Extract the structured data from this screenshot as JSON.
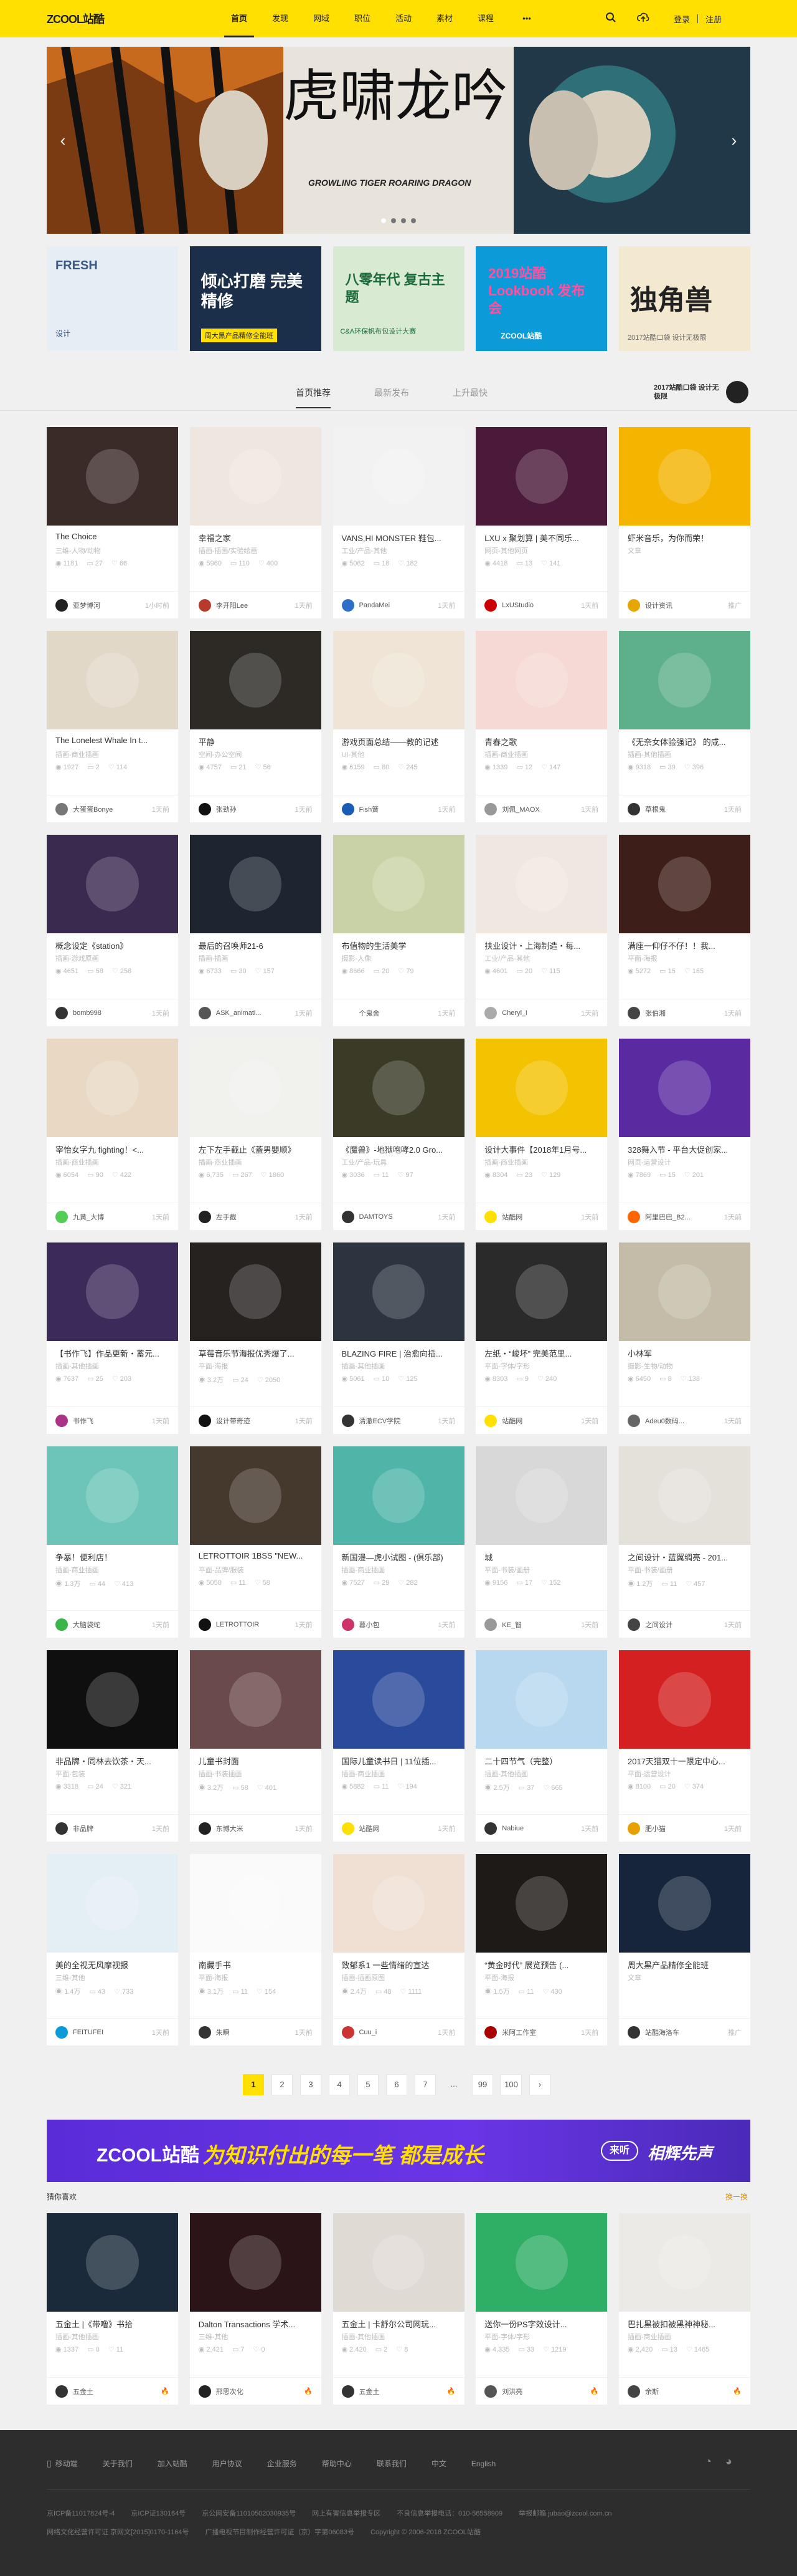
{
  "header": {
    "logo_text": "ZCOOL站酷",
    "nav": [
      "首页",
      "发现",
      "网域",
      "职位",
      "活动",
      "素材",
      "课程"
    ],
    "more": "•••",
    "search_icon": "search-icon",
    "upload_icon": "upload-icon",
    "login": "登录",
    "register": "注册"
  },
  "banner": {
    "caption": "GROWLING TIGER ROARING DRAGON",
    "big_text": "虎啸龙吟"
  },
  "thumbs": [
    {
      "label": "FRESH",
      "color": "#e6edf5",
      "text2": "设计"
    },
    {
      "label": "倾心打磨 完美精修",
      "color": "#1b2f4a",
      "text2": "周大黑产品精修全能班"
    },
    {
      "label": "八零年代 复古主题",
      "color": "#d9ead3",
      "text2": "C&A环保帆布包设计大赛"
    },
    {
      "label": "2019站酷 Lookbook 发布会",
      "color": "#0a9bd8",
      "text2": "ZCOOL站酷"
    },
    {
      "label": "独角兽",
      "color": "#f3e8d0",
      "text2": "2017站酷口袋 设计无极限"
    }
  ],
  "tabs": [
    "首页推荐",
    "最新发布",
    "上升最快"
  ],
  "promo": {
    "text": "2017站酷口袋 设计无极限"
  },
  "cards": [
    {
      "title": "The Choice",
      "sub": "三维-人物/动物",
      "views": "1181",
      "comments": "27",
      "likes": "66",
      "author": "亚梦博河",
      "time": "1小时前",
      "img": "#3a2a28",
      "av": "#222"
    },
    {
      "title": "幸福之家",
      "sub": "插画-插画/实验绘画",
      "views": "5960",
      "comments": "110",
      "likes": "400",
      "author": "李开阳Lee",
      "time": "1天前",
      "img": "#efe7df",
      "av": "#b83a2a"
    },
    {
      "title": "VANS,HI MONSTER 鞋包...",
      "sub": "工业/产品-其他",
      "views": "5062",
      "comments": "18",
      "likes": "182",
      "author": "PandaMei",
      "time": "1天前",
      "img": "#f2f2f2",
      "av": "#2d6ec8"
    },
    {
      "title": "LXU x 聚划算 | 美不同乐...",
      "sub": "网页-其他网页",
      "views": "4418",
      "comments": "13",
      "likes": "141",
      "author": "LxUStudio",
      "time": "1天前",
      "img": "#4b1a3a",
      "av": "#c00"
    },
    {
      "title": "虾米音乐，为你而荣！",
      "sub": "文章",
      "views": "",
      "comments": "",
      "likes": "",
      "author": "设计资讯",
      "time": "推广",
      "img": "#f5b400",
      "av": "#e8a400"
    },
    {
      "title": "The Lonelest Whale In t...",
      "sub": "插画-商业插画",
      "views": "1927",
      "comments": "2",
      "likes": "114",
      "author": "大蛋蛋Bonye",
      "time": "1天前",
      "img": "#e2d8c8",
      "av": "#777"
    },
    {
      "title": "平静",
      "sub": "空间-办公空间",
      "views": "4757",
      "comments": "21",
      "likes": "56",
      "author": "张劲孙",
      "time": "1天前",
      "img": "#2d2a26",
      "av": "#111"
    },
    {
      "title": "游戏页面总结——教的记述",
      "sub": "UI-其他",
      "views": "6159",
      "comments": "80",
      "likes": "245",
      "author": "Fish簧",
      "time": "1天前",
      "img": "#f0e4d6",
      "av": "#1a5bb5"
    },
    {
      "title": "青春之歌",
      "sub": "插画-商业插画",
      "views": "1339",
      "comments": "12",
      "likes": "147",
      "author": "刘佩_MAOX",
      "time": "1天前",
      "img": "#f6d9d4",
      "av": "#999"
    },
    {
      "title": "《无奈女体验强记》 的咸...",
      "sub": "插画-其他插画",
      "views": "9318",
      "comments": "39",
      "likes": "396",
      "author": "草根鬼",
      "time": "1天前",
      "img": "#5db08a",
      "av": "#333"
    },
    {
      "title": "概念设定《station》",
      "sub": "插画-游戏原画",
      "views": "4651",
      "comments": "58",
      "likes": "258",
      "author": "bomb998",
      "time": "1天前",
      "img": "#3a2a50",
      "av": "#333"
    },
    {
      "title": "最后的召唤师21-6",
      "sub": "插画-插画",
      "views": "6733",
      "comments": "30",
      "likes": "157",
      "author": "ASK_animati...",
      "time": "1天前",
      "img": "#1e2530",
      "av": "#555"
    },
    {
      "title": "布值物的生活美学",
      "sub": "摄影-人像",
      "views": "8666",
      "comments": "20",
      "likes": "79",
      "author": "个鬼舍",
      "time": "1天前",
      "img": "#c8d2a6",
      "av": "#fff"
    },
    {
      "title": "扶业设计・上海制造・每...",
      "sub": "工业/产品-其他",
      "views": "4601",
      "comments": "20",
      "likes": "115",
      "author": "Cheryl_i",
      "time": "1天前",
      "img": "#f0e8e0",
      "av": "#aaa"
    },
    {
      "title": "满座一仰仔不仔！！我...",
      "sub": "平面-海报",
      "views": "5272",
      "comments": "15",
      "likes": "165",
      "author": "张伯湘",
      "time": "1天前",
      "img": "#3e1e18",
      "av": "#444"
    },
    {
      "title": "宰怡女字九 fighting！<...",
      "sub": "插画-商业插画",
      "views": "6054",
      "comments": "90",
      "likes": "422",
      "author": "九黄_大博",
      "time": "1天前",
      "img": "#e9d8c4",
      "av": "#5c5"
    },
    {
      "title": "左下左手截止《蓋男嬰顺》",
      "sub": "插画-商业插画",
      "views": "6,735",
      "comments": "267",
      "likes": "1860",
      "author": "左手截",
      "time": "1天前",
      "img": "#f1f1ee",
      "av": "#222"
    },
    {
      "title": "《魔兽》-地狱咆哮2.0 Gro...",
      "sub": "工业/产品-玩具",
      "views": "3036",
      "comments": "11",
      "likes": "97",
      "author": "DAMTOYS",
      "time": "1天前",
      "img": "#3a3a26",
      "av": "#333"
    },
    {
      "title": "设计大事件【2018年1月号...",
      "sub": "插画-商业插画",
      "views": "8304",
      "comments": "23",
      "likes": "129",
      "author": "站酷网",
      "time": "1天前",
      "img": "#f3c200",
      "av": "#ffe000"
    },
    {
      "title": "328舞入节 - 平台大促创家...",
      "sub": "网页-运营设计",
      "views": "7869",
      "comments": "15",
      "likes": "201",
      "author": "阿里巴巴_B2...",
      "time": "1天前",
      "img": "#5a2aa0",
      "av": "#f60"
    },
    {
      "title": "【书作飞】作品更新・蓄元...",
      "sub": "插画-其他插画",
      "views": "7637",
      "comments": "25",
      "likes": "203",
      "author": "书作飞",
      "time": "1天前",
      "img": "#3b2a5a",
      "av": "#a38"
    },
    {
      "title": "草莓音乐节海报优秀爆了...",
      "sub": "平面-海报",
      "views": "3.2万",
      "comments": "24",
      "likes": "2050",
      "author": "设计带奇迹",
      "time": "1天前",
      "img": "#262220",
      "av": "#111"
    },
    {
      "title": "BLAZING FIRE | 治愈向插...",
      "sub": "插画-其他插画",
      "views": "5061",
      "comments": "10",
      "likes": "125",
      "author": "清澈ECV学院",
      "time": "1天前",
      "img": "#2c3440",
      "av": "#333"
    },
    {
      "title": "左纸・“峻坏” 完美范里...",
      "sub": "平面-字体/字形",
      "views": "8303",
      "comments": "9",
      "likes": "240",
      "author": "站酷网",
      "time": "1天前",
      "img": "#2a2a2a",
      "av": "#ffe000"
    },
    {
      "title": "小林军",
      "sub": "摄影-生物/动物",
      "views": "6450",
      "comments": "8",
      "likes": "138",
      "author": "Adeu0数码...",
      "time": "1天前",
      "img": "#c4bca8",
      "av": "#666"
    },
    {
      "title": "争暴！便利店！",
      "sub": "插画-商业插画",
      "views": "1.3万",
      "comments": "44",
      "likes": "413",
      "author": "大脑袋蛇",
      "time": "1天前",
      "img": "#6cc5b8",
      "av": "#39b54a"
    },
    {
      "title": "LETROTTOIR 1BSS \"NEW...",
      "sub": "平面-品牌/服装",
      "views": "5050",
      "comments": "11",
      "likes": "58",
      "author": "LETROTTOIR",
      "time": "1天前",
      "img": "#45382c",
      "av": "#111"
    },
    {
      "title": "新国漫—虎小试图 - (俱乐部)",
      "sub": "插画-商业插画",
      "views": "7527",
      "comments": "29",
      "likes": "282",
      "author": "暮小包",
      "time": "1天前",
      "img": "#4fb5a8",
      "av": "#c36"
    },
    {
      "title": "城",
      "sub": "平面-书装/画册",
      "views": "9156",
      "comments": "17",
      "likes": "152",
      "author": "KE_智",
      "time": "1天前",
      "img": "#d8d8d8",
      "av": "#999"
    },
    {
      "title": "之间设计・蓝翼绸亮 - 201...",
      "sub": "平面-书装/画册",
      "views": "1.2万",
      "comments": "11",
      "likes": "457",
      "author": "之间设计",
      "time": "1天前",
      "img": "#e4e0da",
      "av": "#444"
    },
    {
      "title": "非品牌・同林去饮茶・天...",
      "sub": "平面-包装",
      "views": "3318",
      "comments": "24",
      "likes": "321",
      "author": "非品牌",
      "time": "1天前",
      "img": "#0f0f0f",
      "av": "#333"
    },
    {
      "title": "儿童书封面",
      "sub": "插画-书装插画",
      "views": "3.2万",
      "comments": "58",
      "likes": "401",
      "author": "东博大米",
      "time": "1天前",
      "img": "#6a4a4a",
      "av": "#222"
    },
    {
      "title": "国际儿童读书日 | 11位插...",
      "sub": "插画-商业插画",
      "views": "5882",
      "comments": "11",
      "likes": "194",
      "author": "站酷网",
      "time": "1天前",
      "img": "#2a4a9c",
      "av": "#ffe000"
    },
    {
      "title": "二十四节气（完整）",
      "sub": "插画-其他插画",
      "views": "2.5万",
      "comments": "37",
      "likes": "665",
      "author": "Nabiue",
      "time": "1天前",
      "img": "#b7d8ee",
      "av": "#333"
    },
    {
      "title": "2017天猫双十一限定中心...",
      "sub": "平面-运营设计",
      "views": "8100",
      "comments": "20",
      "likes": "374",
      "author": "肥小猫",
      "time": "1天前",
      "img": "#d42020",
      "av": "#e8a000"
    },
    {
      "title": "美的全视无风摩视报",
      "sub": "三维-其他",
      "views": "1.4万",
      "comments": "43",
      "likes": "733",
      "author": "FEITUFEI",
      "time": "1天前",
      "img": "#e4eef5",
      "av": "#0a9bd8"
    },
    {
      "title": "南藏手书",
      "sub": "平面-海报",
      "views": "3.1万",
      "comments": "11",
      "likes": "154",
      "author": "朱瞬",
      "time": "1天前",
      "img": "#fafafa",
      "av": "#333"
    },
    {
      "title": "致郁系1 一些情绪的宣达",
      "sub": "插画-插画原图",
      "views": "2.4万",
      "comments": "48",
      "likes": "1111",
      "author": "Cuu_i",
      "time": "1天前",
      "img": "#f0e0d4",
      "av": "#c33"
    },
    {
      "title": "“黄金时代”  展览预告 (...",
      "sub": "平面-海报",
      "views": "1.5万",
      "comments": "11",
      "likes": "430",
      "author": "米阿工作室",
      "time": "1天前",
      "img": "#1e1a18",
      "av": "#a00"
    },
    {
      "title": "周大黑产品精修全能班",
      "sub": "文章",
      "views": "",
      "comments": "",
      "likes": "",
      "author": "站酷海洛车",
      "time": "推广",
      "img": "#16253c",
      "av": "#333"
    }
  ],
  "pager": {
    "pages": [
      "1",
      "2",
      "3",
      "4",
      "5",
      "6",
      "7",
      "...",
      "99",
      "100"
    ],
    "next": "›",
    "active": "1"
  },
  "ad": {
    "left": "ZCOOL站酷",
    "middle": "为知识付出的每一笔 都是成长",
    "right_logo": "来听",
    "right": "相辉先声"
  },
  "section": {
    "title": "猜你喜欢",
    "more": "换一换"
  },
  "bottom_cards": [
    {
      "title": "五金土 |《带噜》书拾",
      "sub": "插画-其他插画",
      "views": "1337",
      "comments": "0",
      "likes": "11",
      "author": "五金土",
      "time": "",
      "img": "#1a2a3a",
      "av": "#333",
      "flag": "🔥"
    },
    {
      "title": "Dalton Transactions 学术...",
      "sub": "三维-其他",
      "views": "2,421",
      "comments": "7",
      "likes": "0",
      "author": "邢思次化",
      "time": "",
      "img": "#2a1418",
      "av": "#222",
      "flag": "🔥"
    },
    {
      "title": "五金土 | 卡舒尔公司网玩...",
      "sub": "插画-其他插画",
      "views": "2,420",
      "comments": "2",
      "likes": "8",
      "author": "五金土",
      "time": "",
      "img": "#e0dad4",
      "av": "#333",
      "flag": "🔥"
    },
    {
      "title": "送你一份PS字效设计...",
      "sub": "平面-字体/字形",
      "views": "4,335",
      "comments": "33",
      "likes": "1219",
      "author": "刘洪亮",
      "time": "",
      "img": "#2fae66",
      "av": "#555",
      "flag": "🔥"
    },
    {
      "title": "巴扎黑被扣被黑神神秘...",
      "sub": "插画-商业插画",
      "views": "2,420",
      "comments": "13",
      "likes": "1465",
      "author": "余斯",
      "time": "",
      "img": "#eceae6",
      "av": "#444",
      "flag": "🔥"
    }
  ],
  "footer": {
    "links": [
      "移动端",
      "关于我们",
      "加入站酷",
      "用户协议",
      "企业服务",
      "帮助中心",
      "联系我们",
      "中文",
      "English"
    ],
    "line1": [
      "京ICP备11017824号-4",
      "京ICP证130164号",
      "京公网安备11010502030935号",
      "网上有害信息举报专区",
      "不良信息举报电话：010-56558909",
      "举报邮箱 jubao@zcool.com.cn"
    ],
    "line2": [
      "网络文化经营许可证 京网文[2015]0170-1164号",
      "广播电视节目制作经营许可证（京）字第06083号",
      "Copyright © 2006-2018 ZCOOL站酷"
    ]
  }
}
